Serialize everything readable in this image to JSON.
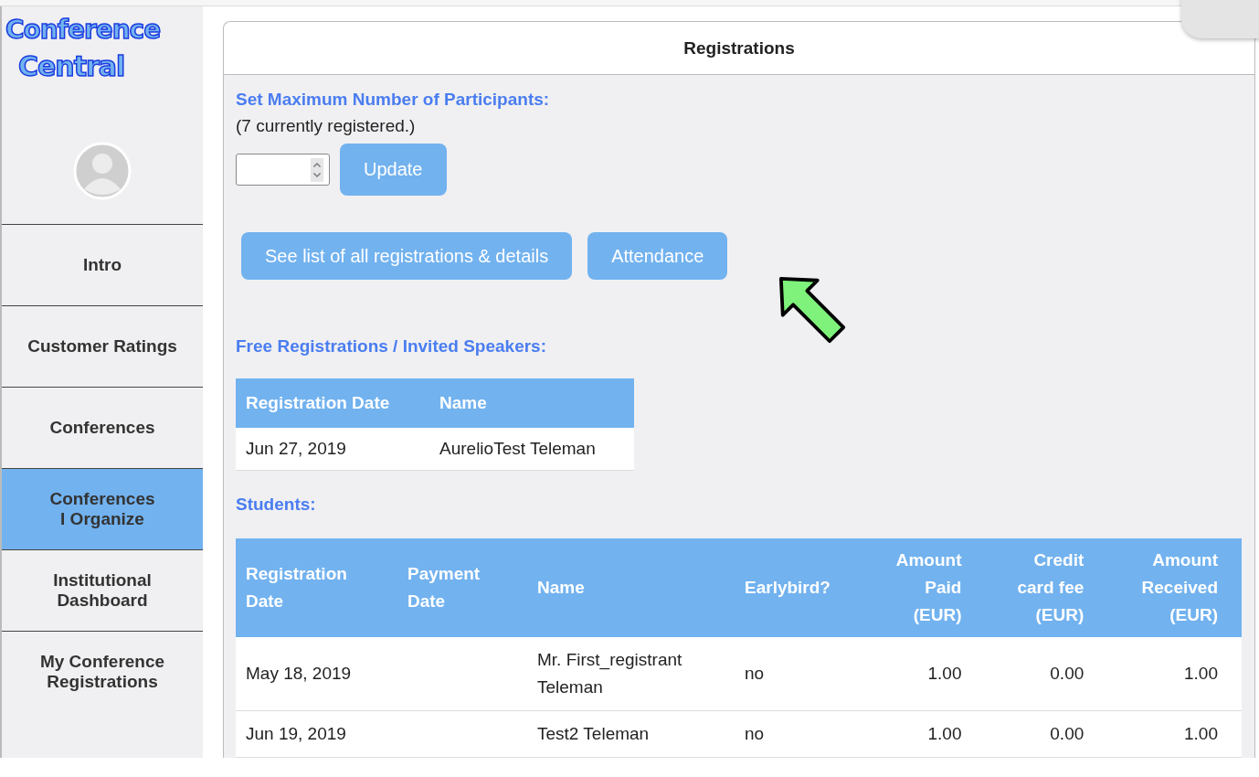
{
  "logo": {
    "lines": [
      "Conference",
      "Central"
    ]
  },
  "sidebar": {
    "items": [
      {
        "lines": [
          "Intro"
        ],
        "selected": false
      },
      {
        "lines": [
          "Customer Ratings"
        ],
        "selected": false
      },
      {
        "lines": [
          "Conferences"
        ],
        "selected": false
      },
      {
        "lines": [
          "Conferences",
          "I Organize"
        ],
        "selected": true
      },
      {
        "lines": [
          "Institutional",
          "Dashboard"
        ],
        "selected": false
      },
      {
        "lines": [
          "My Conference",
          "Registrations"
        ],
        "selected": false
      }
    ]
  },
  "panel": {
    "title": "Registrations",
    "max_participants": {
      "heading": "Set Maximum Number of Participants:",
      "note": "(7 currently registered.)",
      "button": "Update"
    },
    "actions": [
      "See list of all registrations & details",
      "Attendance"
    ],
    "free_section": {
      "heading": "Free Registrations / Invited Speakers:",
      "columns": [
        "Registration Date",
        "Name"
      ],
      "rows": [
        [
          "Jun 27, 2019",
          "AurelioTest Teleman"
        ]
      ]
    },
    "students_section": {
      "heading": "Students:",
      "columns": [
        {
          "lines": [
            "Registration",
            "Date"
          ],
          "kind": "text"
        },
        {
          "lines": [
            "Payment",
            "Date"
          ],
          "kind": "text"
        },
        {
          "lines": [
            "Name"
          ],
          "kind": "text"
        },
        {
          "lines": [
            "Earlybird?"
          ],
          "kind": "text"
        },
        {
          "lines": [
            "Amount",
            "Paid",
            "(EUR)"
          ],
          "kind": "amount"
        },
        {
          "lines": [
            "Credit",
            "card fee",
            "(EUR)"
          ],
          "kind": "amount"
        },
        {
          "lines": [
            "Amount",
            "Received",
            "(EUR)"
          ],
          "kind": "amount"
        }
      ],
      "rows": [
        [
          "May 18, 2019",
          "",
          "Mr. First_registrant Teleman",
          "no",
          "1.00",
          "0.00",
          "1.00"
        ],
        [
          "Jun 19, 2019",
          "",
          "Test2 Teleman",
          "no",
          "1.00",
          "0.00",
          "1.00"
        ]
      ]
    }
  }
}
